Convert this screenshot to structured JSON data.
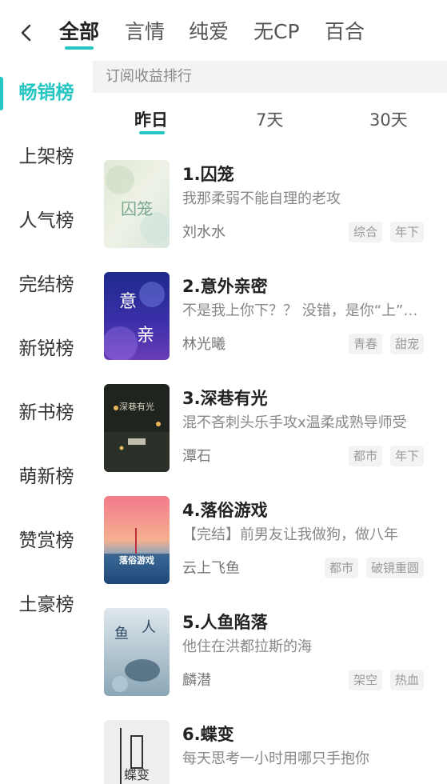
{
  "header": {
    "tabs": [
      {
        "label": "全部",
        "active": true
      },
      {
        "label": "言情",
        "active": false
      },
      {
        "label": "纯爱",
        "active": false
      },
      {
        "label": "无CP",
        "active": false
      },
      {
        "label": "百合",
        "active": false
      }
    ]
  },
  "sidebar": {
    "items": [
      {
        "label": "畅销榜",
        "active": true
      },
      {
        "label": "上架榜",
        "active": false
      },
      {
        "label": "人气榜",
        "active": false
      },
      {
        "label": "完结榜",
        "active": false
      },
      {
        "label": "新锐榜",
        "active": false
      },
      {
        "label": "新书榜",
        "active": false
      },
      {
        "label": "萌新榜",
        "active": false
      },
      {
        "label": "赞赏榜",
        "active": false
      },
      {
        "label": "土豪榜",
        "active": false
      }
    ]
  },
  "main": {
    "subheader": "订阅收益排行",
    "periods": [
      {
        "label": "昨日",
        "active": true
      },
      {
        "label": "7天",
        "active": false
      },
      {
        "label": "30天",
        "active": false
      }
    ],
    "books": [
      {
        "title": "1.囚笼",
        "desc": "我那柔弱不能自理的老攻",
        "author": "刘水水",
        "tags": [
          "综合",
          "年下"
        ],
        "cover_text": "囚笼"
      },
      {
        "title": "2.意外亲密",
        "desc": "不是我上你下？？ 没错，是你“上”…",
        "author": "林光曦",
        "tags": [
          "青春",
          "甜宠"
        ],
        "cover_text": "意外亲密"
      },
      {
        "title": "3.深巷有光",
        "desc": "混不吝刺头乐手攻x温柔成熟导师受",
        "author": "潭石",
        "tags": [
          "都市",
          "年下"
        ],
        "cover_text": "深巷有光"
      },
      {
        "title": "4.落俗游戏",
        "desc": "【完结】前男友让我做狗，做八年",
        "author": "云上飞鱼",
        "tags": [
          "都市",
          "破镜重圆"
        ],
        "cover_text": "落俗游戏"
      },
      {
        "title": "5.人鱼陷落",
        "desc": "他住在洪都拉斯的海",
        "author": "麟潜",
        "tags": [
          "架空",
          "热血"
        ],
        "cover_text": "人鱼陷落"
      },
      {
        "title": "6.蝶变",
        "desc": "每天思考一小时用哪只手抱你",
        "author": "",
        "tags": [],
        "cover_text": "蝶变"
      }
    ]
  },
  "colors": {
    "accent": "#26c6c2",
    "subheader_bg": "#f2f3f5",
    "tag_bg": "#f2f3f5"
  }
}
